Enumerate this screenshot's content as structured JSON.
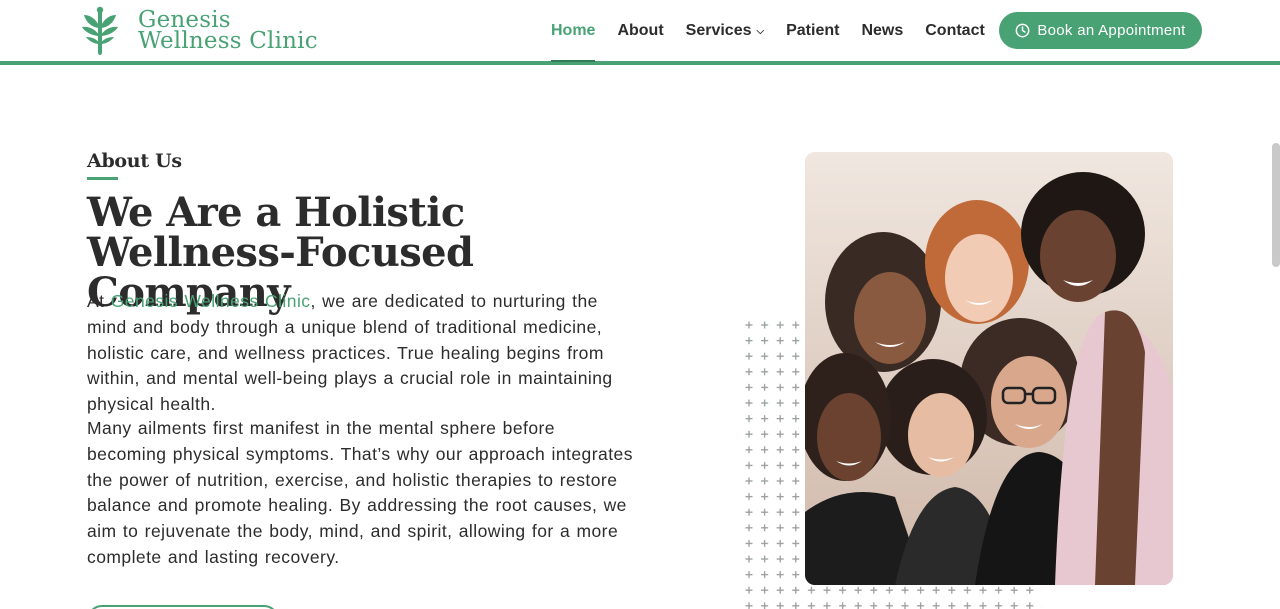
{
  "header": {
    "logo": {
      "line1": "Genesis",
      "line2": "Wellness Clinic"
    },
    "nav": [
      {
        "label": "Home",
        "active": true
      },
      {
        "label": "About",
        "active": false
      },
      {
        "label": "Services",
        "active": false,
        "has_dropdown": true
      },
      {
        "label": "Patient",
        "active": false
      },
      {
        "label": "News",
        "active": false
      },
      {
        "label": "Contact",
        "active": false
      }
    ],
    "book_button": {
      "label": "Book an Appointment",
      "icon": "clock-icon"
    }
  },
  "about": {
    "eyebrow": "About Us",
    "heading": "We Are a Holistic Wellness-Focused Company",
    "para1": {
      "prefix": "At ",
      "link": "Genesis Wellness Clinic",
      "text": ", we are dedicated to nurturing the mind and body through a unique blend of traditional medicine, holistic care, and wellness practices. True healing begins from within, and mental well-being plays a crucial role in maintaining physical health."
    },
    "para2": "Many ailments first manifest in the mental sphere before becoming physical symptoms. That’s why our approach integrates the power of nutrition, exercise, and holistic therapies to restore balance and promote healing. By addressing the root causes, we aim to rejuvenate the body, mind, and spirit, allowing for a more complete and lasting recovery."
  },
  "image": {
    "alt": "Group of smiling women embracing"
  },
  "colors": {
    "brand_green": "#49a274",
    "dark_text": "#2c2c2c"
  }
}
